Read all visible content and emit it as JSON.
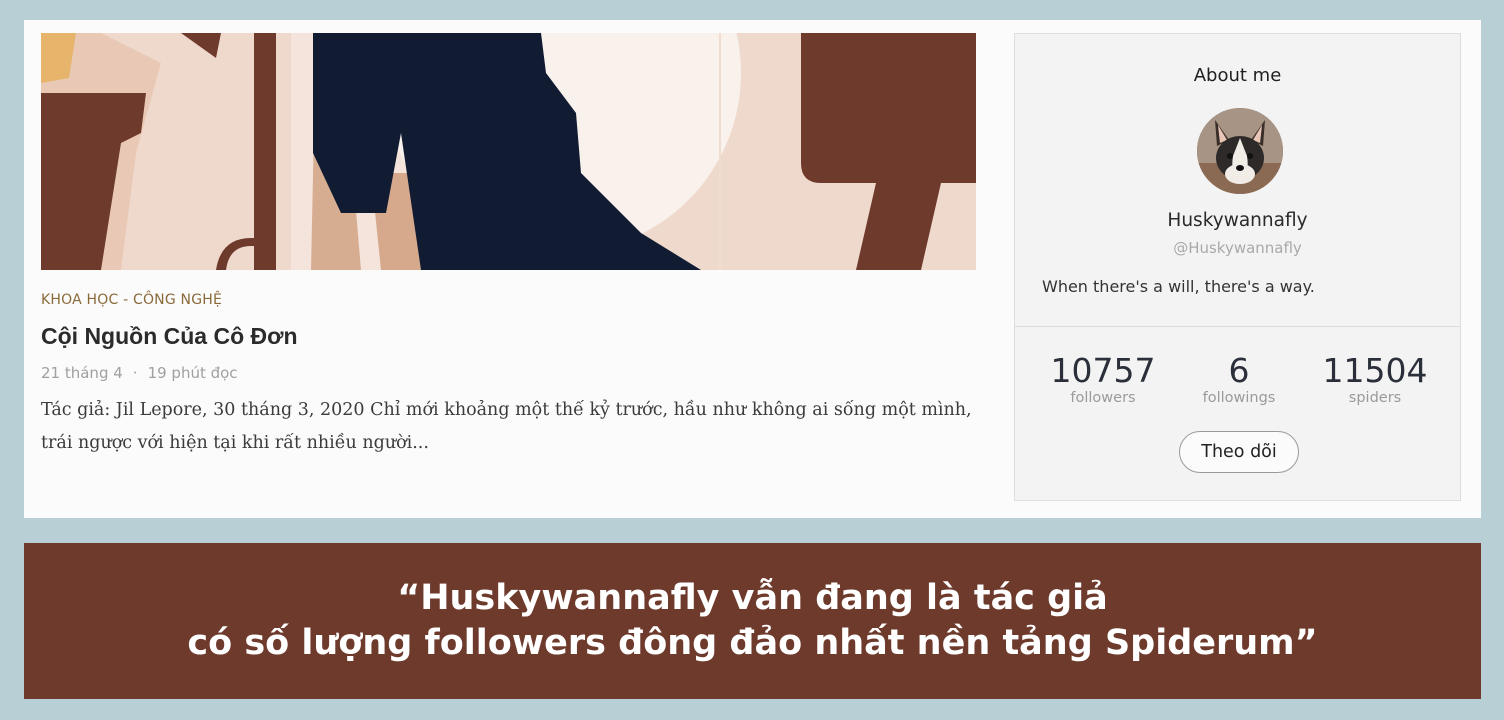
{
  "post": {
    "category": "KHOA HỌC - CÔNG NGHỆ",
    "title": "Cội Nguồn Của Cô Đơn",
    "date": "21 tháng 4",
    "separator": "·",
    "read_time": "19 phút đọc",
    "excerpt_line1": "Tác giả: Jil Lepore, 30 tháng 3, 2020 Chỉ mới khoảng một thế kỷ trước, hầu như không ai sống một mình,",
    "excerpt_line2": "trái ngược với hiện tại khi rất nhiều người..."
  },
  "about": {
    "heading": "About me",
    "username": "Huskywannafly",
    "handle": "@Huskywannafly",
    "bio": "When there's a will, there's a way.",
    "stats": [
      {
        "value": "10757",
        "label": "followers"
      },
      {
        "value": "6",
        "label": "followings"
      },
      {
        "value": "11504",
        "label": "spiders"
      }
    ],
    "follow_label": "Theo dõi"
  },
  "banner": {
    "line1": "“Huskywannafly vẫn đang là tác giả",
    "line2": "có số lượng followers đông đảo nhất nền tảng Spiderum”"
  },
  "colors": {
    "page_bg": "#b9cfd6",
    "banner_bg": "#6e3a2c",
    "category": "#8a6a3a",
    "hero_brown": "#6e3a2c",
    "hero_navy": "#111c33"
  }
}
